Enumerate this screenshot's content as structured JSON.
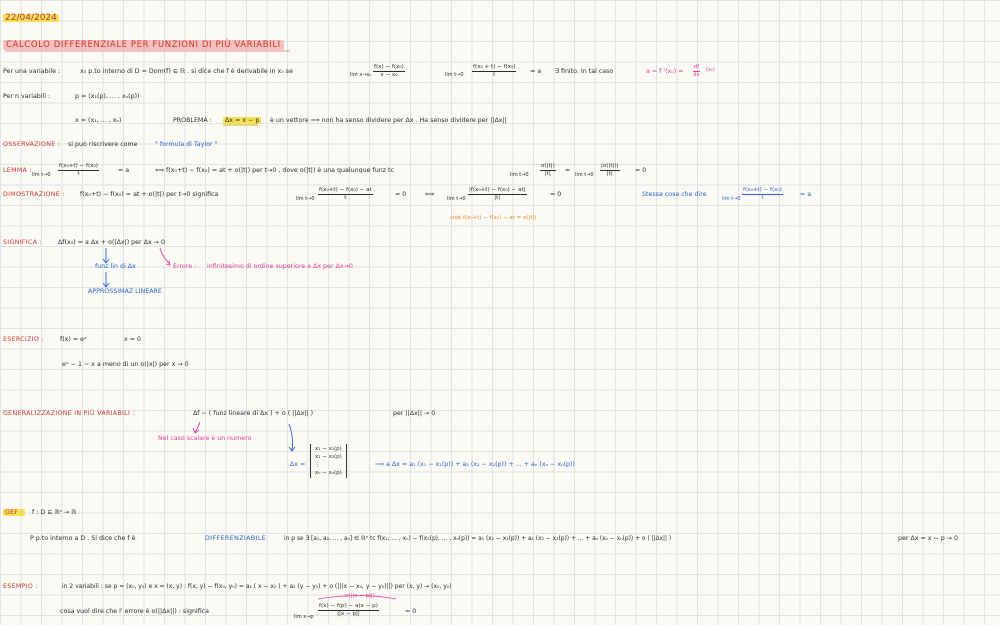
{
  "date": "22/04/2024",
  "title": "CALCOLO DIFFERENZIALE PER FUNZIONI DI PIÙ VARIABILI",
  "lines": {
    "l1a": "Per una variabile :",
    "l1b": "x₀  p.to interno  di  D = Dom(f) ⊆ ℝ .  si  dice  che  f  è  derivabile  in  x₀  se",
    "l1c": "= a",
    "l1d": "∃  finito.  In  tal  caso",
    "l1e": "a = f '(x₀) =",
    "l2a": "Per  n  variabili :",
    "l2b": "p = (x₁(p), ... , xₙ(p))",
    "l3a": "x = (x₁, ... , xₙ)",
    "l3b": "PROBLEMA :",
    "l3c": "Δx = x − p",
    "l3d": "è  un  vettore    ⟹  non  ha  senso  dividere  per  Δx .  Ha  senso  dividere  per  ||Δx||",
    "l4a": "OSSERVAZIONE :",
    "l4b": "si  può  riscrivere  come",
    "l4c": "\" formula  di  Taylor \"",
    "l5a": "LEMMA :",
    "l5b": "= a",
    "l5c": "⟺   f(x₀+t) − f(x₀) = at + o(|t|)    per  t→0 ,  dove  o(|t|)  è  una  qualunque  funz  tc",
    "l5d": "=",
    "l5e": "= 0",
    "l6a": "DIMOSTRAZIONE :",
    "l6b": "f(x₀+t) − f(x₀) = at + o(|t|)    per  t→0    significa",
    "l6c": "= 0",
    "l6d": "⟺",
    "l6e": "= 0",
    "l6f": "Stessa  cosa  che  dire",
    "l6g": "= a",
    "l6h": "cioè   f(x₀+t) − f(x₀) − at = o(|t|)",
    "l7a": "SIGNIFICA :",
    "l7b": "Δf(x₀)  =  a Δx  +  o(|Δx|)        per  Δx → 0",
    "l7c": "funz  lin  di  Δx",
    "l7d": "Errore :",
    "l7e": "infinitesimo  di  ordine  superiore  a  Δx  per  Δx→0",
    "l7f": "APPROSSIMAZ  LINEARE",
    "l8a": "ESERCIZIO :",
    "l8b": "f(x) = eˣ",
    "l8c": "x = 0",
    "l8d": "eˣ − 1 ∼ x      a  meno  di  un  o(|x|)   per  x → 0",
    "l9a": "GENERALIZZAZIONE  IN  PIÙ  VARIABILI :",
    "l9b": "Δf ∼  ( funz  lineare  di  Δx )  + o ( ||Δx|| )",
    "l9c": "per  ||Δx|| → 0",
    "l9d": "Nel  caso  scalare  è  un  numero",
    "l9e": "Δx =",
    "l9f": "⟹   a Δx  =  a₁ (x₁ − x₁(p)) + a₂ (x₂ − x₂(p))  + ... +  aₙ (xₙ − xₙ(p))",
    "l10a": "DEF :",
    "l10b": "f : D ⊆ ℝⁿ → ℝ",
    "l10c": "P  p.to  interno  a  D .   Si  dice  che  f  è",
    "l10d": "DIFFERENZIABILE",
    "l10e": "in  p  se  ∃  [a₁, a₂, ... , aₙ] ∈ ℝⁿ  tc   f(x₁, ... , xₙ) − f(x₁(p), ... , xₙ(p)) = a₁ (x₁ − x₁(p)) + a₂ (x₂ − x₂(p)) + ... + aₙ (xₙ − xₙ(p)) + o ( ||Δx|| )",
    "l10f": "per   Δx = x − p → 0",
    "l11a": "ESEMPIO :",
    "l11b": "in  2  variabili :    se   p = (x₀, y₀)    e   x = (x, y)  :  f(x, y) − f(x₀, y₀) = a₁ ( x − x₀ ) + a₂ (y − y₀) + o (||(x − x₀, y − y₀)||)    per   (x, y) → (x₀, y₀)",
    "l12a": "cosa  vuol  dire  che  l' errore  è  o(||Δx||)  :      significa",
    "l12b": "= 0",
    "l12c": "o(||x − p||)"
  },
  "matrix": [
    "x₁ − x₁(p)",
    "x₂ − x₂(p)",
    "⋮",
    "xₙ − xₙ(p)"
  ],
  "fractions": {
    "f1": {
      "num": "f(x) − f(x₀)",
      "den": "x − x₀",
      "lim": "lim x→x₀"
    },
    "f2": {
      "num": "f(x₀ + t) − f(x₀)",
      "den": "t",
      "lim": "lim t→0"
    },
    "f3": {
      "num": "df",
      "den": "dx",
      "suffix": "(x₀)"
    },
    "f4": {
      "num": "f(x₀+t) − f(x₀)",
      "den": "t",
      "lim": "lim t→0"
    },
    "f5": {
      "num": "o(|t|)",
      "den": "|t|",
      "lim": "lim t→0"
    },
    "f6": {
      "num": "|o(|t|)|",
      "den": "|t|",
      "lim": "lim t→0"
    },
    "f7": {
      "num": "f(x₀+t) − f(x₀) − at",
      "den": "t",
      "lim": "lim t→0"
    },
    "f8": {
      "num": "|f(x₀+t) − f(x₀) − at|",
      "den": "|t|",
      "lim": "lim t→0"
    },
    "f9": {
      "num": "f(x₀+t) − f(x₀)",
      "den": "t",
      "lim": "lim t→0"
    },
    "f10": {
      "num": "f(x) − f(p) − a(x − p)",
      "den": "||x − p||",
      "lim": "lim x→p"
    }
  }
}
